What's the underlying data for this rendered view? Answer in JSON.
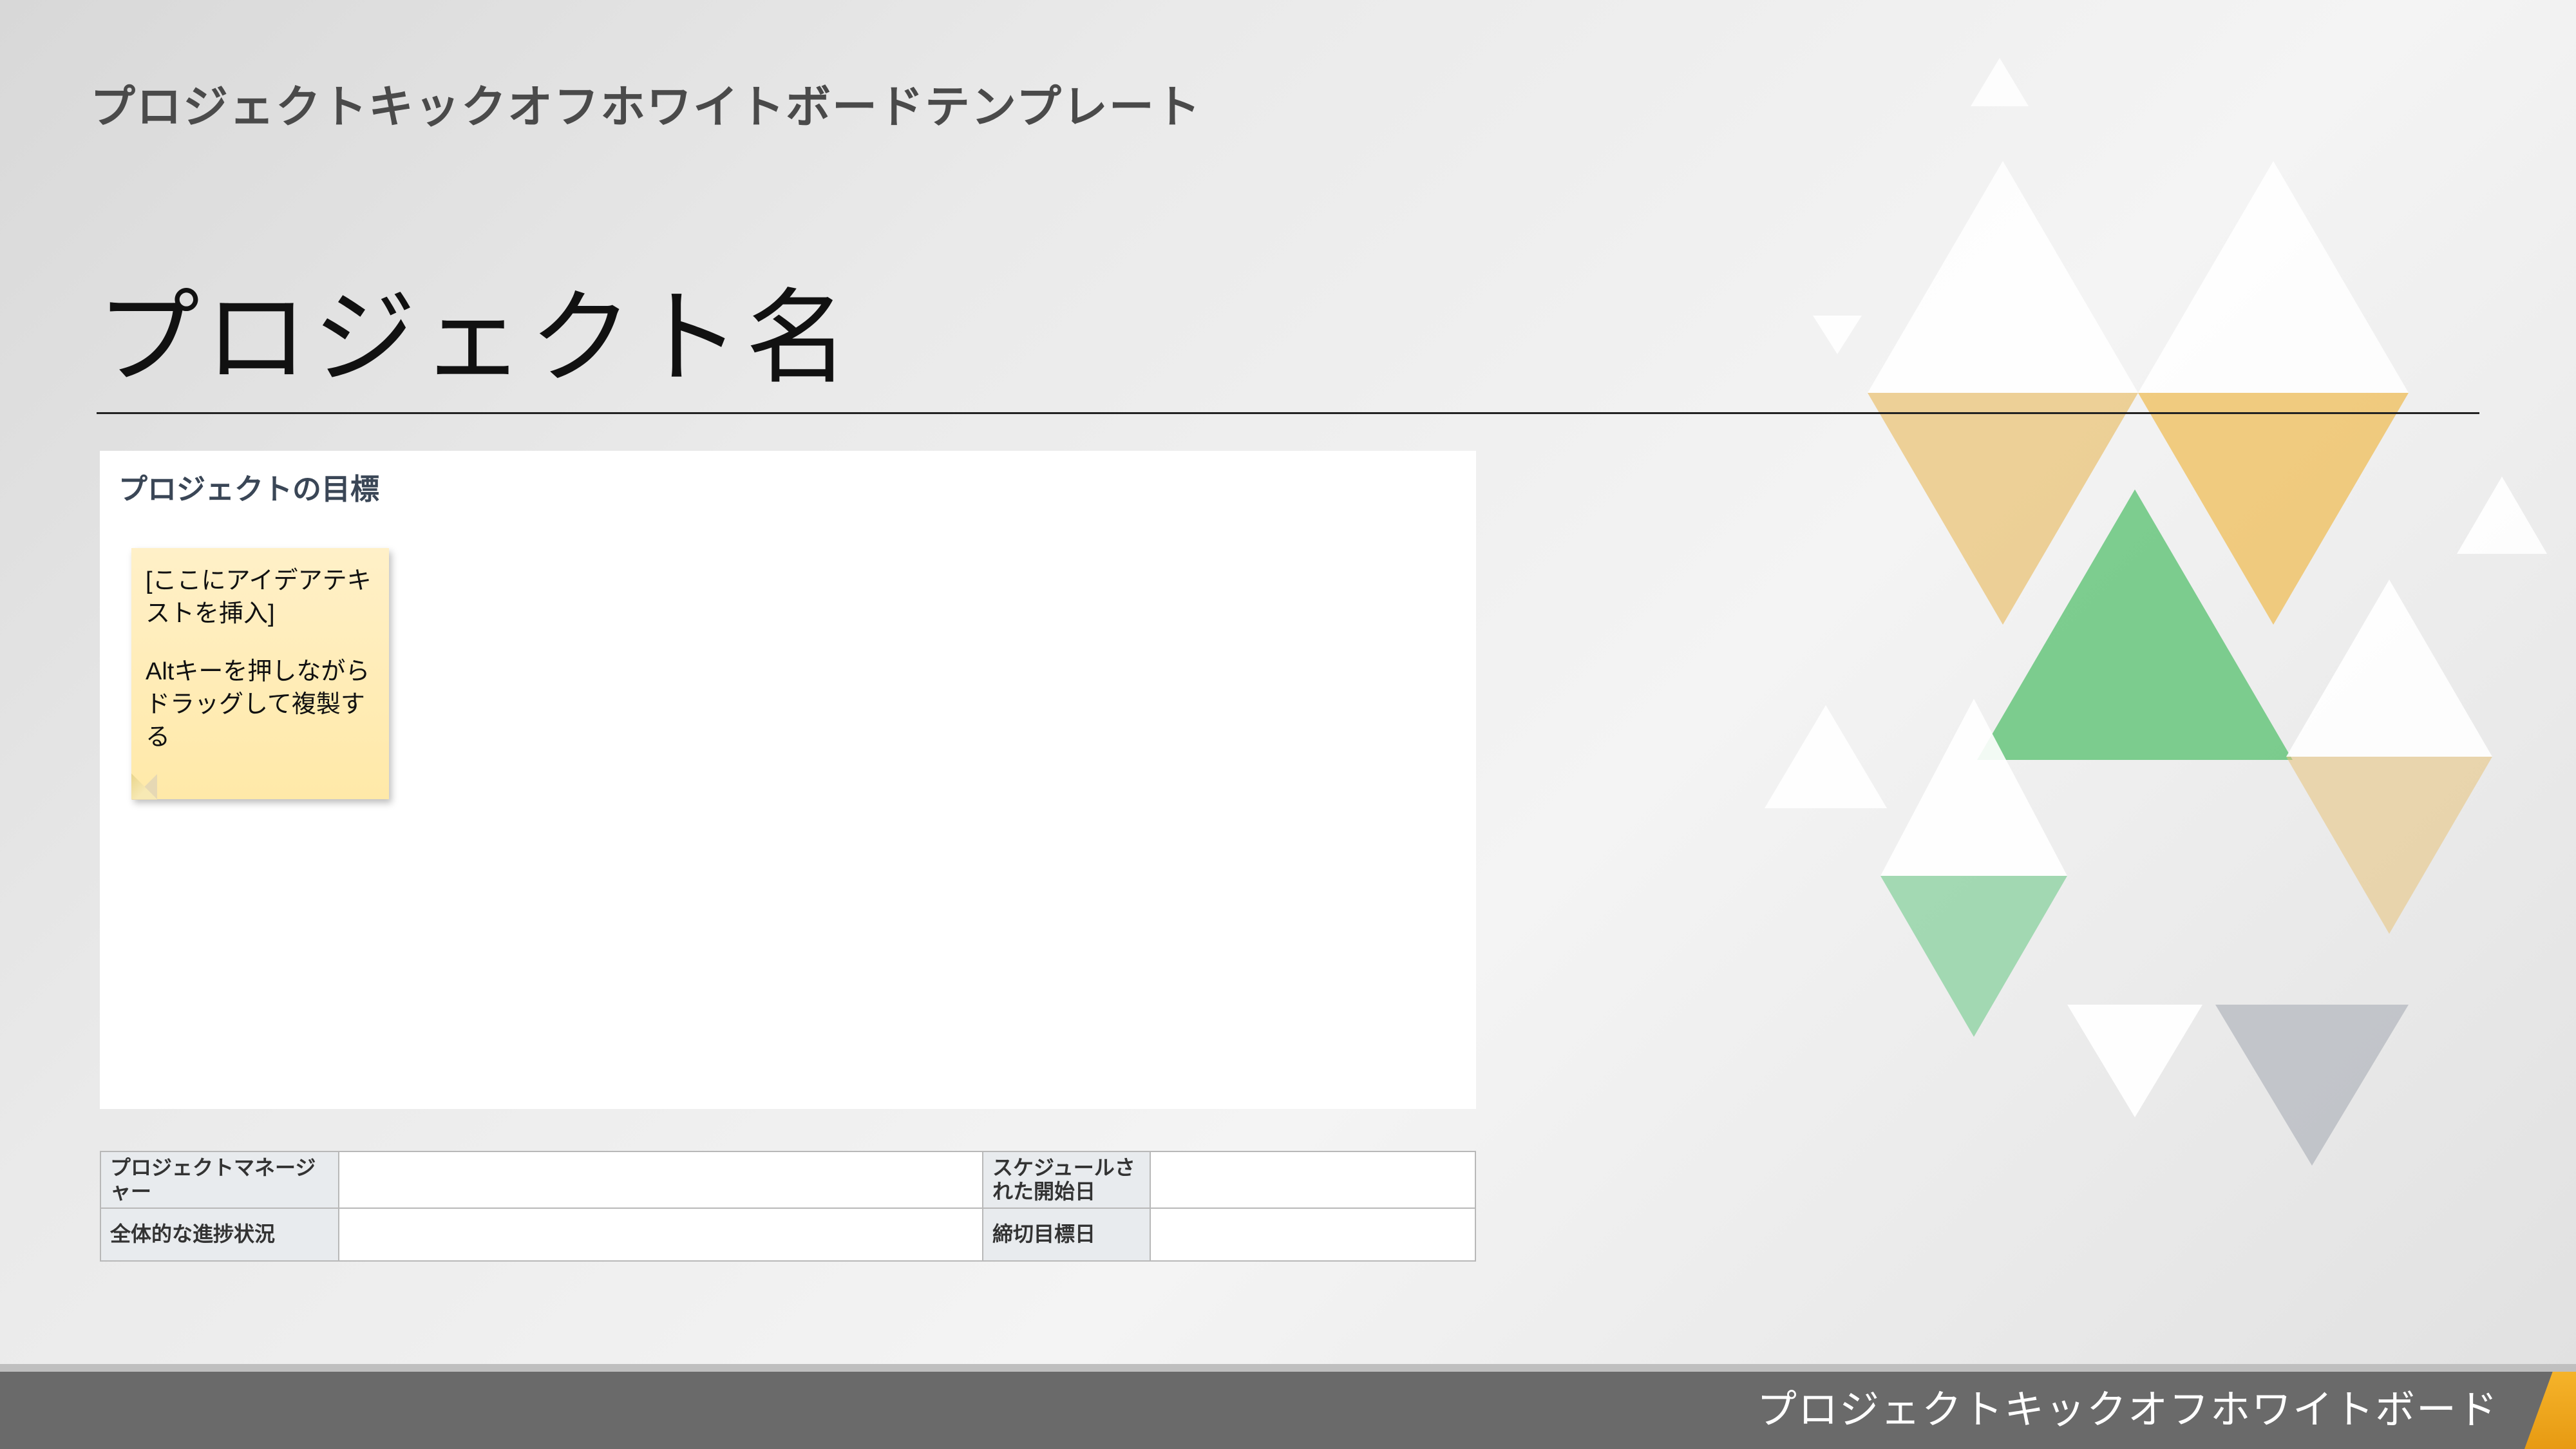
{
  "header": {
    "template_title": "プロジェクトキックオフホワイトボードテンプレート"
  },
  "project": {
    "name_label": "プロジェクト名"
  },
  "goal": {
    "title": "プロジェクトの目標",
    "sticky": {
      "line1": "[ここにアイデアテキストを挿入]",
      "line2": "Altキーを押しながらドラッグして複製する"
    }
  },
  "info": {
    "pm_label": "プロジェクトマネージャー",
    "pm_value": "",
    "start_label": "スケジュールされた開始日",
    "start_value": "",
    "progress_label": "全体的な進捗状況",
    "progress_value": "",
    "deadline_label": "締切目標日",
    "deadline_value": ""
  },
  "footer": {
    "text": "プロジェクトキックオフホワイトボード"
  }
}
